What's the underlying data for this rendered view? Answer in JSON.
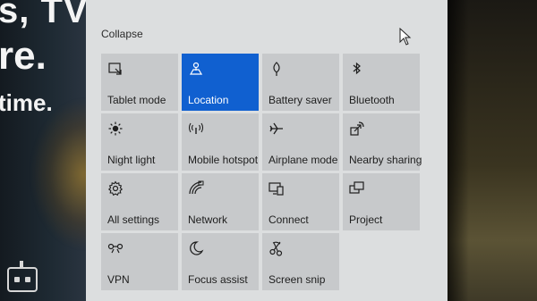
{
  "background": {
    "lines": [
      "s, TV",
      "re.",
      "time."
    ]
  },
  "action_center": {
    "collapse_label": "Collapse",
    "accent_color": "#1060d0",
    "tiles": [
      {
        "label": "Tablet mode",
        "icon": "tablet-mode-icon",
        "active": false
      },
      {
        "label": "Location",
        "icon": "location-icon",
        "active": true
      },
      {
        "label": "Battery saver",
        "icon": "battery-saver-icon",
        "active": false
      },
      {
        "label": "Bluetooth",
        "icon": "bluetooth-icon",
        "active": false
      },
      {
        "label": "Night light",
        "icon": "night-light-icon",
        "active": false
      },
      {
        "label": "Mobile hotspot",
        "icon": "mobile-hotspot-icon",
        "active": false
      },
      {
        "label": "Airplane mode",
        "icon": "airplane-icon",
        "active": false
      },
      {
        "label": "Nearby sharing",
        "icon": "nearby-sharing-icon",
        "active": false
      },
      {
        "label": "All settings",
        "icon": "gear-icon",
        "active": false
      },
      {
        "label": "Network",
        "icon": "network-icon",
        "active": false
      },
      {
        "label": "Connect",
        "icon": "connect-icon",
        "active": false
      },
      {
        "label": "Project",
        "icon": "project-icon",
        "active": false
      },
      {
        "label": "VPN",
        "icon": "vpn-icon",
        "active": false
      },
      {
        "label": "Focus assist",
        "icon": "moon-icon",
        "active": false
      },
      {
        "label": "Screen snip",
        "icon": "screen-snip-icon",
        "active": false
      }
    ]
  }
}
